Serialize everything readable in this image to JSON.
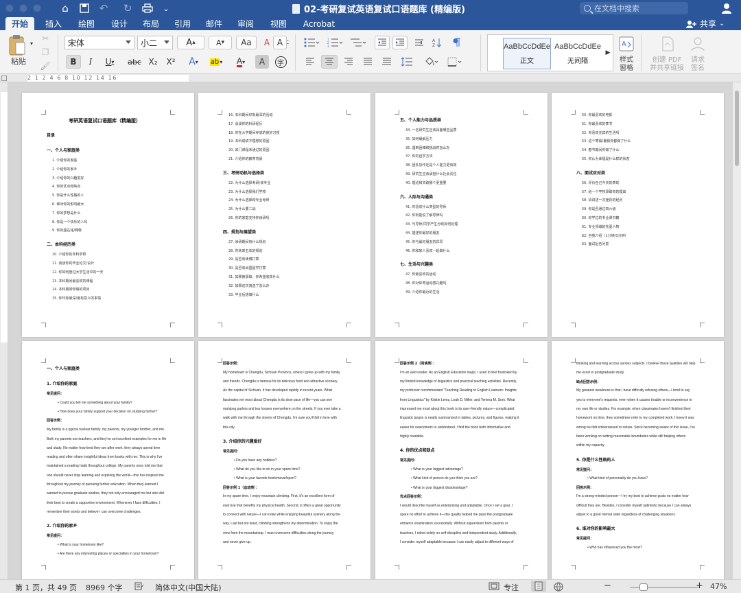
{
  "window": {
    "title": "02-考研复试英语复试口语题库 (精编版)",
    "search_placeholder": "在文档中搜索"
  },
  "tabs": [
    "开始",
    "插入",
    "绘图",
    "设计",
    "布局",
    "引用",
    "邮件",
    "审阅",
    "视图",
    "Acrobat"
  ],
  "active_tab": "开始",
  "share_label": "共享",
  "ribbon": {
    "paste_label": "粘贴",
    "font_name": "宋体",
    "font_size": "小二",
    "bold": "B",
    "italic": "I",
    "underline": "U",
    "strike": "abc",
    "subscript": "X₂",
    "superscript": "X²",
    "grow_font": "A",
    "shrink_font": "A",
    "change_case": "Aa",
    "clear_format": "A",
    "phonetic": "abc",
    "char_border": "A",
    "text_effects": "A",
    "highlight": "ab",
    "font_color": "A",
    "char_shading": "A",
    "enclose_char": "字",
    "styles": [
      {
        "sample": "AaBbCcDdEe",
        "name": "正文"
      },
      {
        "sample": "AaBbCcDdEe",
        "name": "无间隔"
      }
    ],
    "styles_pane_label": "样式\n窗格",
    "create_pdf_label": "创建 PDF\n并共享链接",
    "request_sign_label": "请求\n签名"
  },
  "ruler_scale": "2 1 2 4 6 8 10 12 14 16",
  "pages": [
    {
      "lines": [
        {
          "t": "考研英语复试口语题库（精编版）",
          "c": "title"
        },
        {
          "t": "目录",
          "c": "h"
        },
        {
          "t": "一、个人与家庭类",
          "c": "h"
        },
        {
          "t": "1.   介绍你的家庭",
          "c": ""
        },
        {
          "t": "2.   介绍你的家乡",
          "c": ""
        },
        {
          "t": "3.   介绍你的兴趣爱好",
          "c": ""
        },
        {
          "t": "4.   你的优点和缺点",
          "c": ""
        },
        {
          "t": "5.   你是什么性格的人",
          "c": ""
        },
        {
          "t": "6.   谁对你的影响最大",
          "c": ""
        },
        {
          "t": "7.   你的梦想是什么",
          "c": ""
        },
        {
          "t": "8.   你是一个快乐的人吗",
          "c": ""
        },
        {
          "t": "9.   你的座右铭/偶像",
          "c": ""
        },
        {
          "t": "二、本科经历类",
          "c": "h"
        },
        {
          "t": "10. 介绍你的本科学校",
          "c": ""
        },
        {
          "t": "11. 谈谈你的毕业论文/设计",
          "c": ""
        },
        {
          "t": "12. 你如何度过大学生活中的一天",
          "c": ""
        },
        {
          "t": "13. 本科期间最喜欢的课程",
          "c": ""
        },
        {
          "t": "14. 本科期间你做的项目",
          "c": ""
        },
        {
          "t": "15. 你印象最深/最有意义的事情",
          "c": ""
        }
      ]
    },
    {
      "lines": [
        {
          "t": "16. 本科期间印象最深的活动",
          "c": ""
        },
        {
          "t": "17. 谈谈你的科研经历",
          "c": ""
        },
        {
          "t": "18. 你在大学期间养成的良好习惯",
          "c": ""
        },
        {
          "t": "19. 本科成绩不理想的原因",
          "c": ""
        },
        {
          "t": "20. 来门课程未通过的原因",
          "c": ""
        },
        {
          "t": "21. 介绍你的教育背景",
          "c": ""
        },
        {
          "t": "三、考研动机与选择类",
          "c": "h"
        },
        {
          "t": "22. 为什么选择考研/该专业",
          "c": ""
        },
        {
          "t": "23. 为什么选择我们学校",
          "c": ""
        },
        {
          "t": "24. 为什么选择跨专业考研",
          "c": ""
        },
        {
          "t": "25. 为什么要二战",
          "c": ""
        },
        {
          "t": "26. 你的家庭支持你读研吗",
          "c": ""
        },
        {
          "t": "四、规划与展望类",
          "c": "h"
        },
        {
          "t": "27. 读研期间有什么规划",
          "c": ""
        },
        {
          "t": "28. 你未来五年的规划",
          "c": ""
        },
        {
          "t": "29. 是否有读博打算",
          "c": ""
        },
        {
          "t": "30. 是否有出国留学打算",
          "c": ""
        },
        {
          "t": "31. 如果被录取，你希望收获什么",
          "c": ""
        },
        {
          "t": "32. 如果这次落选了怎么办",
          "c": ""
        },
        {
          "t": "33. 毕业后想做什么",
          "c": ""
        }
      ]
    },
    {
      "lines": [
        {
          "t": "五、个人能力与品质类",
          "c": "h"
        },
        {
          "t": "34. 一名研究生应该具备哪些品质",
          "c": ""
        },
        {
          "t": "35. 如何缓解压力",
          "c": ""
        },
        {
          "t": "36. 遇到困难和挑战时怎么办",
          "c": ""
        },
        {
          "t": "37. 你的自学方法",
          "c": ""
        },
        {
          "t": "38. 团队协作还是个人能力更有效",
          "c": ""
        },
        {
          "t": "39. 研究生应该承担什么社会责任",
          "c": ""
        },
        {
          "t": "40. 理论和实践哪个更重要",
          "c": ""
        },
        {
          "t": "六、人际与沟通类",
          "c": "h"
        },
        {
          "t": "41. 你喜欢什么类型的导师",
          "c": ""
        },
        {
          "t": "42. 你有能说了解导师吗",
          "c": ""
        },
        {
          "t": "43. 与导师/同学产生分歧如何处理",
          "c": ""
        },
        {
          "t": "44. 描述你最好的朋友",
          "c": ""
        },
        {
          "t": "45. 你与最好朋友的异同",
          "c": ""
        },
        {
          "t": "46. 你和家人喜欢一起做什么",
          "c": ""
        },
        {
          "t": "七、生活与兴趣类",
          "c": "h"
        },
        {
          "t": "47. 你最喜欢的运动",
          "c": ""
        },
        {
          "t": "48. 你对体育运动感兴趣吗",
          "c": ""
        },
        {
          "t": "49. 介绍你最近的生活",
          "c": ""
        }
      ]
    },
    {
      "lines": [
        {
          "t": "50. 你最喜欢的电影",
          "c": ""
        },
        {
          "t": "51. 你最喜欢的季节",
          "c": ""
        },
        {
          "t": "52. 你喜欢无宾的生活吗",
          "c": ""
        },
        {
          "t": "53. 这个寒假/暑假你都做了什么",
          "c": ""
        },
        {
          "t": "54. 春节期间你做了什么",
          "c": ""
        },
        {
          "t": "55. 你认为幸福是什么样的状态",
          "c": ""
        },
        {
          "t": "八、面试应对类",
          "c": "h"
        },
        {
          "t": "56. 评价自己今天的表现",
          "c": ""
        },
        {
          "t": "57. 给一个学校录取你的理由",
          "c": ""
        },
        {
          "t": "58. 请讲述一次挫折的经历",
          "c": ""
        },
        {
          "t": "59. 你是否通过四六级",
          "c": ""
        },
        {
          "t": "60. 你学过的专业课书籍",
          "c": ""
        },
        {
          "t": "61. 专业领域的先驱人物",
          "c": ""
        },
        {
          "t": "62. 自我介绍（1分钟/3分钟）",
          "c": ""
        },
        {
          "t": "63. 面试后告问复",
          "c": ""
        }
      ]
    },
    {
      "lines": [
        {
          "t": "一、个人与家庭类",
          "c": "h"
        },
        {
          "t": "1. 介绍你的家庭",
          "c": "h"
        },
        {
          "t": "常见提问：",
          "c": "sub"
        },
        {
          "t": "•   Could you tell me something about your family?",
          "c": "en"
        },
        {
          "t": "•   How does your family support your decision on studying further?",
          "c": "en"
        },
        {
          "t": "回答示例：",
          "c": "sub"
        },
        {
          "t": "My family is a typical nuclear family: my parents, my younger brother, and me.",
          "c": "en"
        },
        {
          "t": "Both my parents are teachers, and they've set excellent examples for me in life",
          "c": "en"
        },
        {
          "t": "and study. No matter how tired they are after work, they always spend time",
          "c": "en"
        },
        {
          "t": "reading and often share insightful ideas from books with me. This is why I've",
          "c": "en"
        },
        {
          "t": "maintained a reading habit throughout college. My parents once told me that",
          "c": "en"
        },
        {
          "t": "one should never stop learning and exploring the world—this has inspired me",
          "c": "en"
        },
        {
          "t": "throughout my journey of pursuing further education. When they learned I",
          "c": "en"
        },
        {
          "t": "wanted to pursue graduate studies, they not only encouraged me but also did",
          "c": "en"
        },
        {
          "t": "their best to create a supportive environment. Whenever I face difficulties, I",
          "c": "en"
        },
        {
          "t": "remember their words and believe I can overcome challenges.",
          "c": "en"
        },
        {
          "t": "2. 介绍你的家乡",
          "c": "h"
        },
        {
          "t": "常见提问：",
          "c": "sub"
        },
        {
          "t": "•   What is your hometown like?",
          "c": "en"
        },
        {
          "t": "•   Are there any interesting places or specialties in your hometown?",
          "c": "en"
        }
      ]
    },
    {
      "lines": [
        {
          "t": "回答示例：",
          "c": "sub"
        },
        {
          "t": "My hometown is Chengdu, Sichuan Province, where I grew up with my family",
          "c": "en"
        },
        {
          "t": "and friends. Chengdu is famous for its delicious food and attractive scenery.",
          "c": "en"
        },
        {
          "t": "As the capital of Sichuan, it has developed rapidly in recent years. What",
          "c": "en"
        },
        {
          "t": "fascinates me most about Chengdu is its slow pace of life—you can see",
          "c": "en"
        },
        {
          "t": "mahjong parlors and tea houses everywhere on the streets. If you ever take a",
          "c": "en"
        },
        {
          "t": "walk with me through the streets of Chengdu, I'm sure you'll fall in love with",
          "c": "en"
        },
        {
          "t": "this city.",
          "c": "en"
        },
        {
          "t": "3. 介绍你的兴趣爱好",
          "c": "h"
        },
        {
          "t": "常见提问：",
          "c": "sub"
        },
        {
          "t": "•   Do you have any hobbies?",
          "c": "en"
        },
        {
          "t": "•   What do you like to do in your spare time?",
          "c": "en"
        },
        {
          "t": "•   What is your favorite book/movie/sport?",
          "c": "en"
        },
        {
          "t": "回答示例 1（运动类）：",
          "c": "sub"
        },
        {
          "t": "In my spare time, I enjoy mountain climbing. First, it's an excellent form of",
          "c": "en"
        },
        {
          "t": "exercise that benefits my physical health. Second, it offers a great opportunity",
          "c": "en"
        },
        {
          "t": "to connect with nature—I can relax while enjoying beautiful scenery along the",
          "c": "en"
        },
        {
          "t": "way. Last but not least, climbing strengthens my determination. To enjoy the",
          "c": "en"
        },
        {
          "t": "view from the mountaintop, I must overcome difficulties along the journey",
          "c": "en"
        },
        {
          "t": "and never give up.",
          "c": "en"
        }
      ]
    },
    {
      "lines": [
        {
          "t": "回答示例 2（阅读类）：",
          "c": "sub"
        },
        {
          "t": "I'm an avid reader. As an English Education major, I used to feel frustrated by",
          "c": "en"
        },
        {
          "t": "my limited knowledge of linguistics and practical teaching activities. Recently,",
          "c": "en"
        },
        {
          "t": "my professor recommended \"Teaching Reading to English Learners: Insights",
          "c": "en"
        },
        {
          "t": "from Linguistics\" by Kristin Lems, Leah D. Miller, and Tenena M. Soro. What",
          "c": "en"
        },
        {
          "t": "impressed me most about this book is its user-friendly nature—complicated",
          "c": "en"
        },
        {
          "t": "linguistic jargon is neatly summarized in tables, pictures, and figures, making it",
          "c": "en"
        },
        {
          "t": "easier for newcomers to understand. I find the book both informative and",
          "c": "en"
        },
        {
          "t": "highly readable.",
          "c": "en"
        },
        {
          "t": "4. 你的优点和缺点",
          "c": "h"
        },
        {
          "t": "常见提问：",
          "c": "sub"
        },
        {
          "t": "•   What is your biggest advantage?",
          "c": "en"
        },
        {
          "t": "•   What kind of person do you think you are?",
          "c": "en"
        },
        {
          "t": "•   What is your biggest disadvantage?",
          "c": "en"
        },
        {
          "t": "优点回答示例：",
          "c": "sub"
        },
        {
          "t": "I would describe myself as enterprising and adaptable. Once I set a goal, I",
          "c": "en"
        },
        {
          "t": "spare no effort to achieve it—this quality helped me pass the postgraduate",
          "c": "en"
        },
        {
          "t": "entrance examination successfully. Without supervision from parents or",
          "c": "en"
        },
        {
          "t": "teachers, I relied solely on self-discipline and independent study. Additionally,",
          "c": "en"
        },
        {
          "t": "I consider myself adaptable because I can easily adjust to different ways of",
          "c": "en"
        }
      ]
    },
    {
      "lines": [
        {
          "t": "thinking and learning across various subjects. I believe these qualities will help",
          "c": "en"
        },
        {
          "t": "me excel in postgraduate study.",
          "c": "en"
        },
        {
          "t": "缺点回答示例：",
          "c": "sub"
        },
        {
          "t": "My greatest weakness is that I have difficulty refusing others—I tend to say",
          "c": "en"
        },
        {
          "t": "yes to everyone's requests, even when it causes trouble or inconvenience in",
          "c": "en"
        },
        {
          "t": "my own life or studies. For example, when classmates haven't finished their",
          "c": "en"
        },
        {
          "t": "homework on time, they sometimes refer to my completed work. I knew it was",
          "c": "en"
        },
        {
          "t": "wrong but felt embarrassed to refuse. Since becoming aware of this issue, I've",
          "c": "en"
        },
        {
          "t": "been working on setting reasonable boundaries while still helping others",
          "c": "en"
        },
        {
          "t": "within my capacity.",
          "c": "en"
        },
        {
          "t": "5. 你是什么性格的人",
          "c": "h"
        },
        {
          "t": "常见提问：",
          "c": "sub"
        },
        {
          "t": "•   What kind of personality do you have?",
          "c": "en"
        },
        {
          "t": "回答示例：",
          "c": "sub"
        },
        {
          "t": "I'm a strong-minded person—I try my best to achieve goals no matter how",
          "c": "en"
        },
        {
          "t": "difficult they are. Besides, I consider myself optimistic because I can always",
          "c": "en"
        },
        {
          "t": "adjust to a good mental state regardless of challenging situations.",
          "c": "en"
        },
        {
          "t": "6. 谁对你的影响最大",
          "c": "h"
        },
        {
          "t": "常见提问：",
          "c": "sub"
        },
        {
          "t": "•   Who has influenced you the most?",
          "c": "en"
        }
      ]
    }
  ],
  "status": {
    "page_info": "第 1 页，共 49 页",
    "word_count": "8969 个字",
    "language": "简体中文(中国大陆)",
    "focus": "专注",
    "zoom": "47%"
  }
}
